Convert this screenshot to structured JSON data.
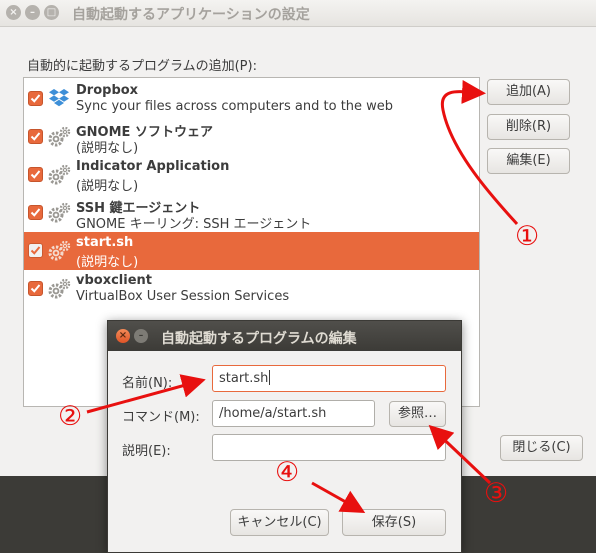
{
  "main_window": {
    "title": "自動起動するアプリケーションの設定",
    "close_glyph": "×",
    "min_glyph": "–",
    "max_glyph": "□",
    "list_label": "自動的に起動するプログラムの追加(P):",
    "items": [
      {
        "name": "Dropbox",
        "description": "Sync your files across computers and to the web",
        "checked": true,
        "icon": "dropbox-icon",
        "selected": false
      },
      {
        "name": "GNOME ソフトウェア",
        "description": "(説明なし)",
        "checked": true,
        "icon": "gears-icon",
        "selected": false
      },
      {
        "name": "Indicator Application",
        "description": "(説明なし)",
        "checked": true,
        "icon": "gears-icon",
        "selected": false
      },
      {
        "name": "SSH 鍵エージェント",
        "description": "GNOME キーリング: SSH エージェント",
        "checked": true,
        "icon": "gears-icon",
        "selected": false
      },
      {
        "name": "start.sh",
        "description": "(説明なし)",
        "checked": true,
        "icon": "gears-icon",
        "selected": true
      },
      {
        "name": "vboxclient",
        "description": "VirtualBox User Session Services",
        "checked": true,
        "icon": "gears-icon",
        "selected": false
      }
    ],
    "buttons": {
      "add": "追加(A)",
      "remove": "削除(R)",
      "edit": "編集(E)",
      "close": "閉じる(C)"
    }
  },
  "dialog": {
    "title": "自動起動するプログラムの編集",
    "close_glyph": "×",
    "min_glyph": "–",
    "name_label": "名前(N):",
    "name_value": "start.sh",
    "command_label": "コマンド(M):",
    "command_value": "/home/a/start.sh",
    "browse_label": "参照…",
    "comment_label": "説明(E):",
    "comment_value": "",
    "cancel_label": "キャンセル(C)",
    "save_label": "保存(S)"
  },
  "annotations": {
    "step1": "①",
    "step2": "②",
    "step3": "③",
    "step4": "④",
    "color": "#e8100f"
  },
  "colors": {
    "accent": "#e8693c",
    "dialog_titlebar": "#3c3b37",
    "window_bg": "#f2f1f0"
  }
}
